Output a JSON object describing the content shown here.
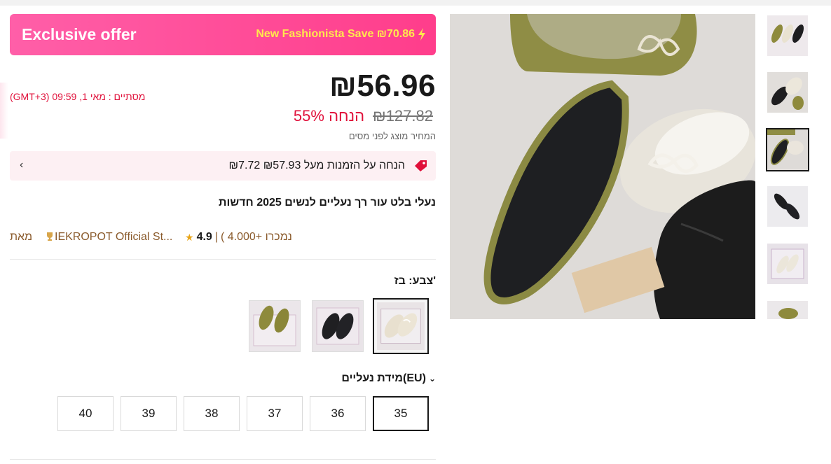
{
  "banner": {
    "title": "Exclusive offer",
    "save": "New Fashionista Save ₪70.86"
  },
  "pricing": {
    "price": "₪56.96",
    "discount": "55% הנחה",
    "original": "₪127.82",
    "tax_note": "המחיר מוצג לפני מסים",
    "countdown": "מסתיים :  מאי 1, 09:59 (GMT+3)"
  },
  "coupon": {
    "text": "₪7.72 הנחה על הזמנות מעל ₪57.93"
  },
  "product": {
    "title": "נעלי בלט עור רך נעליים לנשים 2025 חדשות"
  },
  "store": {
    "from": "מאת",
    "name": "IEKROPOT Official St...",
    "rating": "4.9",
    "sold": "( נמכרו +4.000"
  },
  "color": {
    "label": "צבע: בז'",
    "options": [
      "beige",
      "black",
      "green"
    ],
    "selected": "beige"
  },
  "size": {
    "label": "מידת נעליים(EU)",
    "options": [
      "35",
      "36",
      "37",
      "38",
      "39",
      "40"
    ],
    "selected": "35"
  },
  "gallery": {
    "thumb_count": 6,
    "selected_thumb": 3
  },
  "colors": {
    "accent": "#ff3d8b",
    "price_red": "#e0103a",
    "store_brown": "#8a5a2b"
  }
}
